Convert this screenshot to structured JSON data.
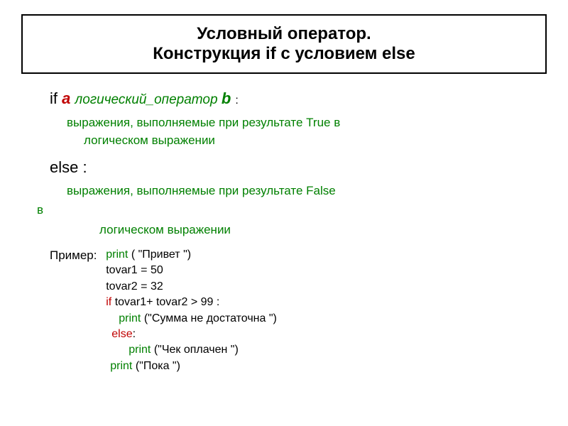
{
  "title": {
    "line1": "Условный оператор.",
    "line2": "Конструкция if с условием else"
  },
  "syntax": {
    "if_kw": "if ",
    "var_a": "a ",
    "logical_op": "логический_оператор ",
    "var_b": "b ",
    "colon": ":",
    "desc_true_1": "выражения, выполняемые при результате True в",
    "desc_true_2": "логическом выражении",
    "else_line": "else :",
    "desc_false_1": "выражения, выполняемые при результате False",
    "line_v": "в",
    "line_vlog": "логическом выражении"
  },
  "example": {
    "label": "Пример:",
    "code": {
      "l1_print": "print ",
      "l1_arg": "( \"Привет \")",
      "l2": "tovar1 = 50",
      "l3": "tovar2 = 32",
      "l4_if": "if ",
      "l4_rest": " tovar1+ tovar2 > 99 :",
      "l5_print": "print ",
      "l5_arg": "(\"Сумма не достаточна \")",
      "l6_else": "else",
      "l6_colon": ":",
      "l7_print": "print ",
      "l7_arg": "(\"Чек оплачен \")",
      "l8_print": "print ",
      "l8_arg": "(\"Пока \")"
    }
  }
}
